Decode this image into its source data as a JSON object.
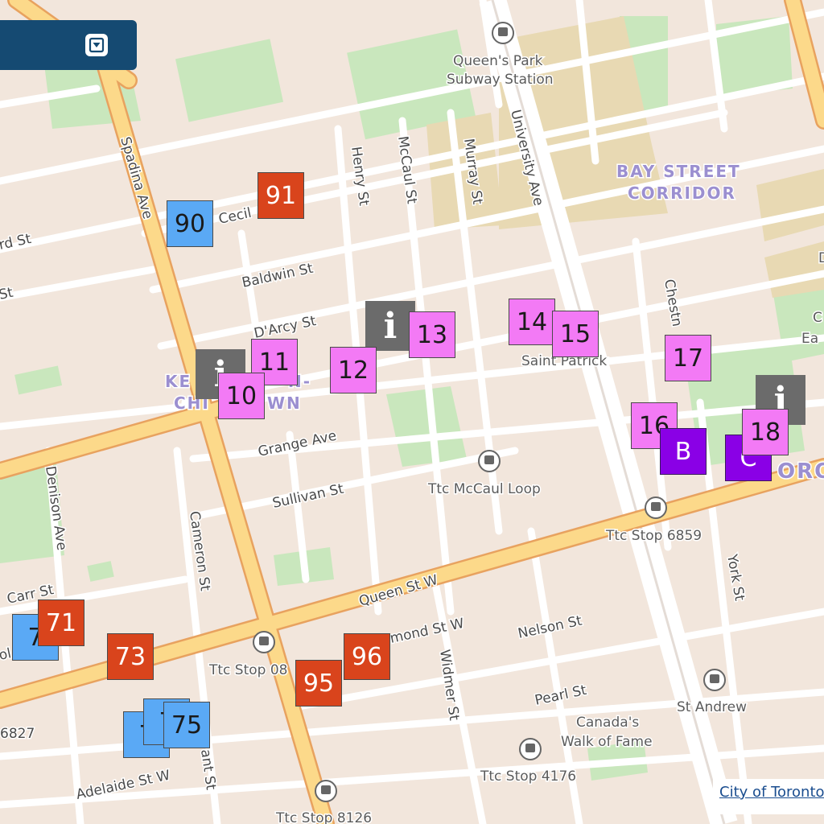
{
  "map": {
    "streets": {
      "spadina": "Spadina Ave",
      "cecil": "Cecil",
      "baldwin": "Baldwin St",
      "darcy": "D'Arcy St",
      "henry": "Henry St",
      "mccaul": "McCaul St",
      "murray": "Murray St",
      "university": "University Ave",
      "grange": "Grange Ave",
      "sullivan": "Sullivan St",
      "queen": "Queen St W",
      "richmond": "mond St W",
      "nelson": "Nelson St",
      "pearl": "Pearl St",
      "adelaide": "Adelaide St W",
      "denison": "Denison Ave",
      "cameron": "Cameron St",
      "carr": "Carr St",
      "widmer": "Widmer St",
      "york": "York St",
      "chestnut": "Chestn",
      "left_rd": "rd St",
      "left_st": "St",
      "left_ol": "ol",
      "left_6827": "6827",
      "brant": "ant St"
    },
    "places": {
      "queens_park_1": "Queen's Park",
      "queens_park_2": "Subway Station",
      "bay_1": "BAY STREET",
      "bay_2": "CORRIDOR",
      "kensington_1": "KE",
      "kensington_1b": "N-",
      "kensington_2": "CHI",
      "kensington_2b": "WN",
      "saint_patrick": "Saint Patrick",
      "ttc_mccaul": "Ttc McCaul Loop",
      "ttc_6859": "Ttc Stop 6859",
      "ttc_08": "Ttc Stop 08",
      "ttc_4176": "Ttc Stop 4176",
      "ttc_8126": "Ttc Stop 8126",
      "st_andrew": "St Andrew",
      "walk_1": "Canada's",
      "walk_2": "Walk of Fame",
      "toronto_partial": "ORO",
      "right_d": "D",
      "right_c": "C",
      "right_ea": "Ea"
    }
  },
  "markers": {
    "m90": "90",
    "m91": "91",
    "m10": "10",
    "m11": "11",
    "m12": "12",
    "m13": "13",
    "m14": "14",
    "m15": "15",
    "m16": "16",
    "m17": "17",
    "m18": "18",
    "m71": "71",
    "m7a": "7",
    "m73": "73",
    "m7b": "7",
    "m7c": "7",
    "m75": "75",
    "m95": "95",
    "m96": "96"
  },
  "letters": {
    "b": "B",
    "c": "C"
  },
  "info_icon": "i",
  "toolbar": {
    "icon": "dropdown-icon"
  },
  "credit": "City of Toronto",
  "colors": {
    "blue": "#5aa9f5",
    "red": "#d9441c",
    "pink": "#f37af5",
    "purple": "#8a00e6",
    "gray": "#6b6b6b",
    "toolbar": "#154a72"
  }
}
